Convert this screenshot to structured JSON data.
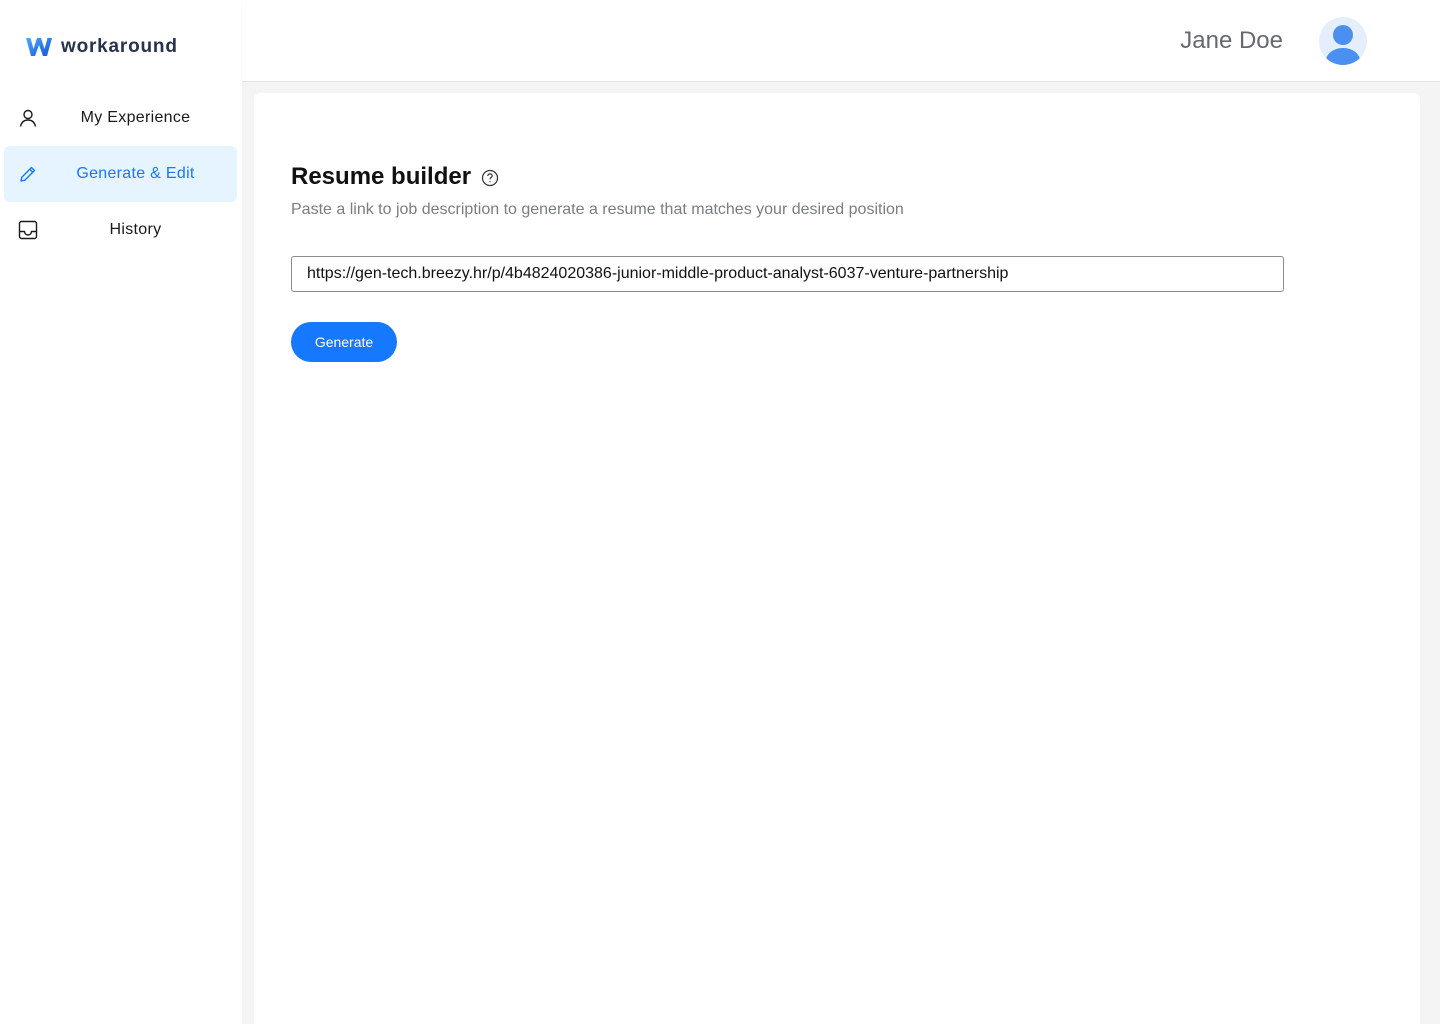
{
  "brand": {
    "name": "workaround",
    "icon": "w-logo-icon",
    "colors": {
      "primary": "#1677ff",
      "dark": "#26334d"
    }
  },
  "sidebar": {
    "items": [
      {
        "label": "My Experience",
        "icon": "user-icon",
        "active": false
      },
      {
        "label": "Generate & Edit",
        "icon": "pencil-icon",
        "active": true
      },
      {
        "label": "History",
        "icon": "inbox-icon",
        "active": false
      }
    ]
  },
  "header": {
    "user_name": "Jane Doe",
    "avatar_icon": "avatar-icon"
  },
  "main": {
    "title": "Resume builder",
    "help_icon": "question-circle-icon",
    "subtitle": "Paste a link to job description to generate a resume that matches your desired position",
    "url_input": {
      "value": "https://gen-tech.breezy.hr/p/4b4824020386-junior-middle-product-analyst-6037-venture-partnership",
      "placeholder": ""
    },
    "generate_label": "Generate"
  }
}
